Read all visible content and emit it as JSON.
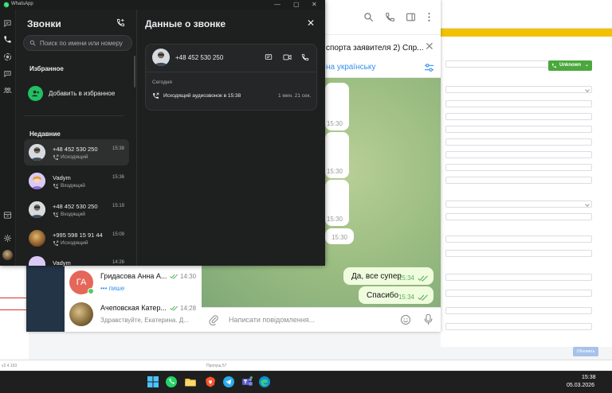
{
  "colors": {
    "wa_bg": "#1e1f1f",
    "wa_accent": "#21c063",
    "tg_accent": "#3390ec",
    "tg_out_bubble": "#effdde",
    "crm_banner": "#f2c200",
    "crm_green": "#4aa83c"
  },
  "whatsapp": {
    "app_title": "WhatsApp",
    "window_controls": {
      "minimize": "—",
      "maximize": "▢",
      "close": "✕"
    },
    "rail_icons": [
      "chats-icon",
      "calls-icon",
      "status-icon",
      "channels-icon",
      "communities-icon",
      "archive-icon",
      "settings-icon",
      "profile-avatar"
    ],
    "calls_panel": {
      "title": "Звонки",
      "search_placeholder": "Поиск по имени или номеру",
      "favorites_heading": "Избранное",
      "add_favorite_label": "Добавить в избранное",
      "recent_heading": "Недавние",
      "items": [
        {
          "name": "+48 452 530 250",
          "type": "Исходящий",
          "time": "15:38",
          "selected": true
        },
        {
          "name": "Vadym",
          "type": "Входящий",
          "time": "15:36",
          "selected": false
        },
        {
          "name": "+48 452 530 250",
          "type": "Входящий",
          "time": "15:19",
          "selected": false
        },
        {
          "name": "+995 598 15 91 44",
          "type": "Исходящий",
          "time": "15:09",
          "selected": false
        },
        {
          "name": "Vadym",
          "type": "",
          "time": "14:26",
          "selected": false
        }
      ]
    },
    "details_panel": {
      "title": "Данные о звонке",
      "close_label": "✕",
      "number": "+48 452 530 250",
      "date_label": "Сегодня",
      "call_text": "Исходящий аудиозвонок в 15:38",
      "duration": "1 мин. 21 сек."
    }
  },
  "telegram": {
    "pinned_text": "спорта заявителя 2) Спр...",
    "pinned_close": "✕",
    "translate_text": "на українську",
    "messages": [
      {
        "text": "",
        "time": "15:30",
        "out": false
      },
      {
        "text": "",
        "time": "15:30",
        "out": false
      },
      {
        "text": "",
        "time": "15:30",
        "out": false
      },
      {
        "text": "",
        "time": "15:30",
        "out": false
      },
      {
        "text": "Да, все супер",
        "time": "15:34",
        "out": true
      },
      {
        "text": "Спасибо",
        "time": "15:34",
        "out": true
      }
    ],
    "input_placeholder": "Написати повідомлення...",
    "chat_list": [
      {
        "initials": "ГА",
        "name": "Гридасова Анна А...",
        "time": "14:30",
        "preview": "••• пише"
      },
      {
        "initials": "",
        "name": "Ачеповская Катер...",
        "time": "14:28",
        "preview": "Здравствуйте, Екатерина. Д..."
      }
    ]
  },
  "crm": {
    "unknown_button": "Unknown",
    "update_button": "Обновить",
    "status_left": "v2.4.163",
    "status_right": "Пропущ 57"
  },
  "taskbar": {
    "time": "15:38",
    "date": "05.03.2026",
    "icons": [
      "windows-start-icon",
      "whatsapp-icon",
      "file-explorer-icon",
      "brave-browser-icon",
      "telegram-icon",
      "teams-icon",
      "edge-icon"
    ]
  }
}
